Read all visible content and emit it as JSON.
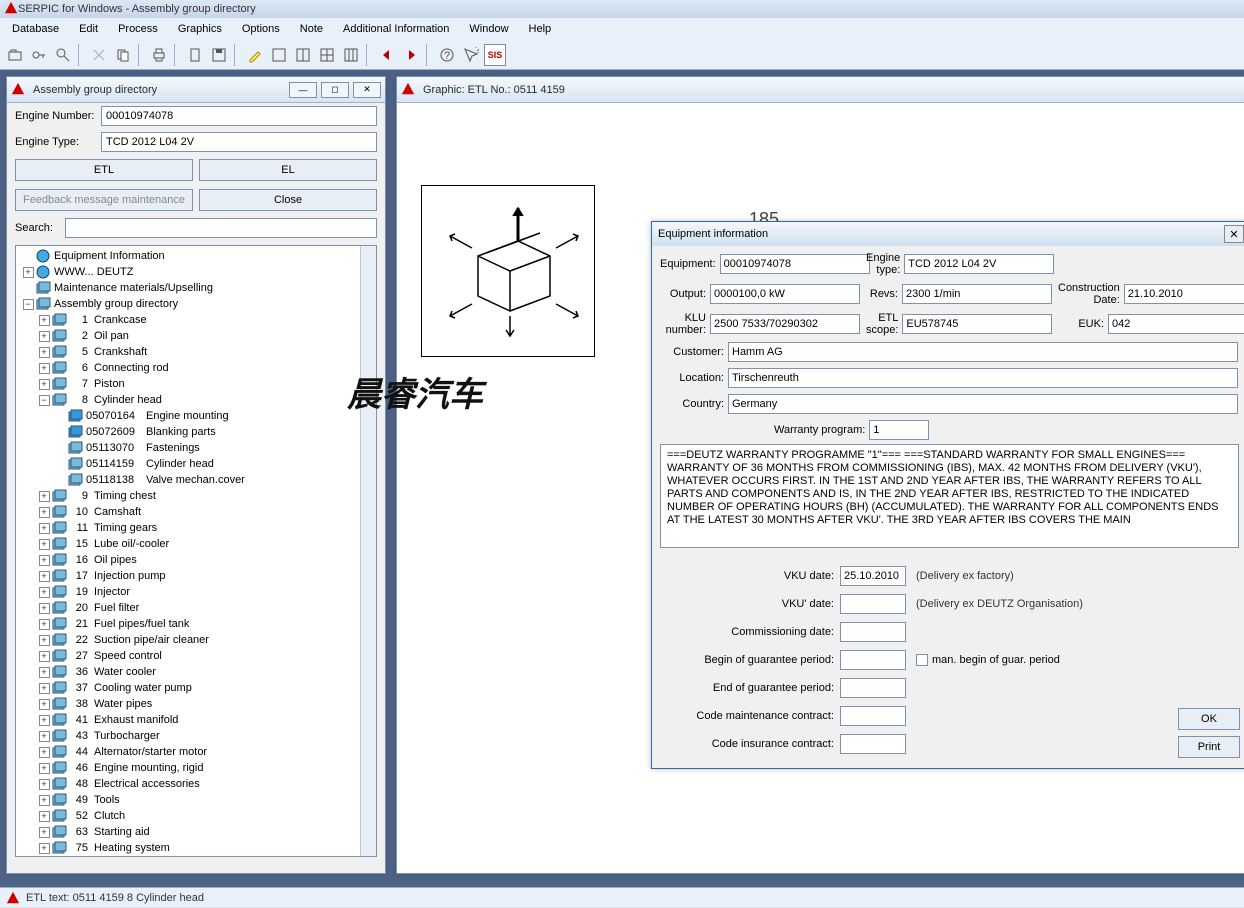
{
  "app": {
    "title": "SERPIC for Windows - Assembly group directory"
  },
  "menu": [
    "Database",
    "Edit",
    "Process",
    "Graphics",
    "Options",
    "Note",
    "Additional Information",
    "Window",
    "Help"
  ],
  "left": {
    "title": "Assembly group directory",
    "engine_number_label": "Engine Number:",
    "engine_number": "00010974078",
    "engine_type_label": "Engine Type:",
    "engine_type": "TCD 2012 L04 2V",
    "btn_etl": "ETL",
    "btn_el": "EL",
    "btn_feedback": "Feedback message maintenance",
    "btn_close": "Close",
    "search_label": "Search:",
    "search_value": "",
    "root_equipment": "Equipment Information",
    "root_www": "WWW... DEUTZ",
    "root_maint": "Maintenance materials/Upselling",
    "root_agd": "Assembly group directory",
    "agd": [
      {
        "n": "1",
        "t": "Crankcase",
        "exp": true
      },
      {
        "n": "2",
        "t": "Oil pan",
        "exp": true
      },
      {
        "n": "5",
        "t": "Crankshaft",
        "exp": true
      },
      {
        "n": "6",
        "t": "Connecting rod",
        "exp": true
      },
      {
        "n": "7",
        "t": "Piston",
        "exp": true
      },
      {
        "n": "8",
        "t": "Cylinder head",
        "exp": true,
        "open": true,
        "children": [
          {
            "c": "05070164",
            "t": "Engine mounting",
            "blue": true
          },
          {
            "c": "05072609",
            "t": "Blanking parts",
            "blue": true
          },
          {
            "c": "05113070",
            "t": "Fastenings"
          },
          {
            "c": "05114159",
            "t": "Cylinder head"
          },
          {
            "c": "05118138",
            "t": "Valve mechan.cover"
          }
        ]
      },
      {
        "n": "9",
        "t": "Timing chest",
        "exp": true
      },
      {
        "n": "10",
        "t": "Camshaft",
        "exp": true
      },
      {
        "n": "11",
        "t": "Timing gears",
        "exp": true
      },
      {
        "n": "15",
        "t": "Lube oil/-cooler",
        "exp": true
      },
      {
        "n": "16",
        "t": "Oil pipes",
        "exp": true
      },
      {
        "n": "17",
        "t": "Injection pump",
        "exp": true
      },
      {
        "n": "19",
        "t": "Injector",
        "exp": true
      },
      {
        "n": "20",
        "t": "Fuel filter",
        "exp": true
      },
      {
        "n": "21",
        "t": "Fuel pipes/fuel tank",
        "exp": true
      },
      {
        "n": "22",
        "t": "Suction pipe/air cleaner",
        "exp": true
      },
      {
        "n": "27",
        "t": "Speed control",
        "exp": true
      },
      {
        "n": "36",
        "t": "Water cooler",
        "exp": true
      },
      {
        "n": "37",
        "t": "Cooling water pump",
        "exp": true
      },
      {
        "n": "38",
        "t": "Water pipes",
        "exp": true
      },
      {
        "n": "41",
        "t": "Exhaust manifold",
        "exp": true
      },
      {
        "n": "43",
        "t": "Turbocharger",
        "exp": true
      },
      {
        "n": "44",
        "t": "Alternator/starter motor",
        "exp": true
      },
      {
        "n": "46",
        "t": "Engine mounting, rigid",
        "exp": true
      },
      {
        "n": "48",
        "t": "Electrical accessories",
        "exp": true
      },
      {
        "n": "49",
        "t": "Tools",
        "exp": true
      },
      {
        "n": "52",
        "t": "Clutch",
        "exp": true
      },
      {
        "n": "63",
        "t": "Starting aid",
        "exp": true
      },
      {
        "n": "75",
        "t": "Heating system",
        "exp": true
      }
    ]
  },
  "right": {
    "title": "Graphic: ETL No.: 0511 4159"
  },
  "watermark": "晨睿汽车",
  "dialog": {
    "title": "Equipment information",
    "fields": {
      "equipment_l": "Equipment:",
      "equipment": "00010974078",
      "engine_type_l": "Engine type:",
      "engine_type": "TCD 2012 L04 2V",
      "output_l": "Output:",
      "output": "0000100,0 kW",
      "revs_l": "Revs:",
      "revs": "2300 1/min",
      "construction_l": "Construction Date:",
      "construction": "21.10.2010",
      "klu_l": "KLU number:",
      "klu": "2500 7533/70290302",
      "etlscope_l": "ETL scope:",
      "etlscope": "EU578745",
      "euk_l": "EUK:",
      "euk": "042",
      "customer_l": "Customer:",
      "customer": "Hamm AG",
      "location_l": "Location:",
      "location": "Tirschenreuth",
      "country_l": "Country:",
      "country": "Germany",
      "warrprog_l": "Warranty program:",
      "warrprog": "1"
    },
    "warranty_text": "===DEUTZ WARRANTY PROGRAMME \"1\"===\n===STANDARD WARRANTY FOR SMALL ENGINES===\nWARRANTY OF 36 MONTHS FROM COMMISSIONING (IBS), MAX. 42 MONTHS FROM DELIVERY (VKU'), WHATEVER OCCURS FIRST. IN THE 1ST AND 2ND YEAR AFTER IBS, THE WARRANTY REFERS TO ALL PARTS AND COMPONENTS AND IS, IN THE 2ND YEAR AFTER IBS, RESTRICTED TO THE INDICATED NUMBER OF OPERATING HOURS (BH) (ACCUMULATED). THE WARRANTY FOR ALL COMPONENTS ENDS AT THE LATEST 30 MONTHS AFTER VKU'. THE 3RD YEAR AFTER IBS COVERS THE MAIN",
    "lower": {
      "vku_l": "VKU date:",
      "vku": "25.10.2010",
      "vku_note": "(Delivery ex factory)",
      "vku2_l": "VKU' date:",
      "vku2": "",
      "vku2_note": "(Delivery ex DEUTZ Organisation)",
      "comm_l": "Commissioning date:",
      "comm": "",
      "bog_l": "Begin of guarantee period:",
      "bog": "",
      "bog_cb": "man. begin of guar. period",
      "eog_l": "End of guarantee period:",
      "eog": "",
      "maint_l": "Code maintenance contract:",
      "maint": "",
      "ins_l": "Code insurance contract:",
      "ins": ""
    },
    "ok": "OK",
    "print": "Print"
  },
  "status": "ETL text: 0511 4159     8    Cylinder head"
}
